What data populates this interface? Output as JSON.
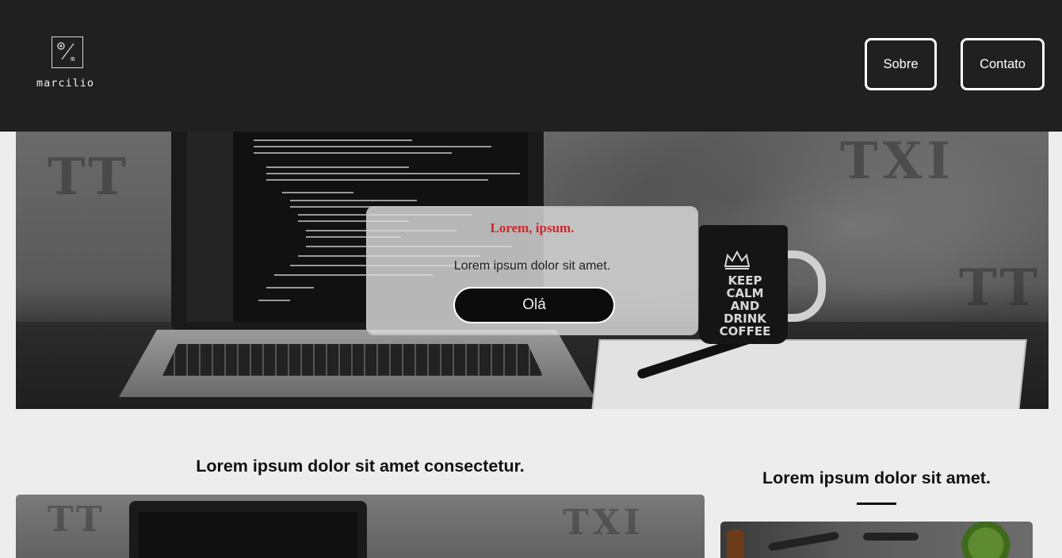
{
  "header": {
    "logo_text": "marcilio",
    "nav": [
      {
        "label": "Sobre"
      },
      {
        "label": "Contato"
      }
    ]
  },
  "hero": {
    "card_title": "Lorem, ipsum.",
    "card_text": "Lorem ipsum dolor sit amet.",
    "card_button": "Olá",
    "mug_text": "KEEP CALM AND DRINK COFFEE"
  },
  "content": {
    "left_title": "Lorem ipsum dolor sit amet consectetur.",
    "right_title": "Lorem ipsum dolor sit amet."
  },
  "colors": {
    "header_bg": "#202020",
    "page_bg": "#ededed",
    "card_title": "#d1262a",
    "button_bg": "#0c0c0c"
  }
}
